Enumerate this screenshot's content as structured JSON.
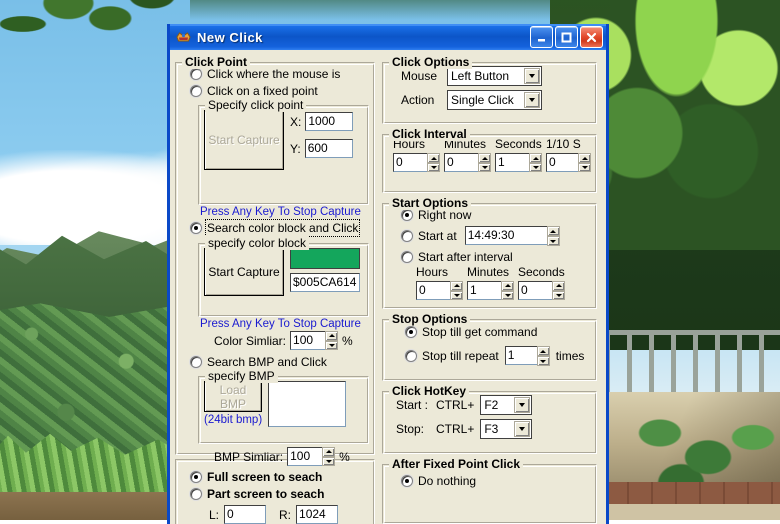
{
  "window": {
    "title": "New Click",
    "icon": "app-crown-icon",
    "buttons": {
      "minimize": "minimize-icon",
      "maximize": "maximize-icon",
      "close": "close-icon"
    }
  },
  "click_point": {
    "title": "Click Point",
    "options": [
      {
        "label": "Click where the mouse is",
        "selected": false
      },
      {
        "label": "Click on a fixed point",
        "selected": false
      },
      {
        "label": "Search color block and Click",
        "selected": true,
        "focused": true
      },
      {
        "label": "Search BMP and Click",
        "selected": false
      }
    ],
    "specify_click_point": {
      "title": "Specify click point",
      "capture_button": "Start Capture",
      "capture_enabled": false,
      "x_label": "X:",
      "x_value": "1000",
      "y_label": "Y:",
      "y_value": "600",
      "hint": "Press Any Key To Stop Capture"
    },
    "specify_color_block": {
      "title": "specify color block",
      "capture_button": "Start Capture",
      "swatch_color": "#14a65c",
      "color_value": "$005CA614",
      "hint": "Press Any Key To Stop Capture",
      "similar_label": "Color Simliar:",
      "similar_value": "100",
      "percent": "%"
    },
    "specify_bmp": {
      "title": "specify BMP",
      "load_button": "Load BMP",
      "load_enabled": false,
      "note": "(24bit bmp)",
      "similar_label": "BMP Simliar:",
      "similar_value": "100",
      "percent": "%"
    },
    "screen_scope": {
      "full": {
        "label": "Full screen to seach",
        "selected": true
      },
      "part": {
        "label": "Part screen to seach",
        "selected": false
      },
      "left_label": "L:",
      "left_value": "0",
      "right_label": "R:",
      "right_value": "1024"
    }
  },
  "click_options": {
    "title": "Click Options",
    "mouse_label": "Mouse",
    "mouse_value": "Left Button",
    "action_label": "Action",
    "action_value": "Single Click"
  },
  "click_interval": {
    "title": "Click Interval",
    "fields": [
      {
        "label": "Hours",
        "value": "0"
      },
      {
        "label": "Minutes",
        "value": "0"
      },
      {
        "label": "Seconds",
        "value": "1"
      },
      {
        "label": "1/10 S",
        "value": "0"
      }
    ]
  },
  "start_options": {
    "title": "Start Options",
    "right_now": {
      "label": "Right now",
      "selected": true
    },
    "start_at": {
      "label": "Start at",
      "selected": false,
      "value": "14:49:30"
    },
    "start_after": {
      "label": "Start after interval",
      "selected": false
    },
    "interval_fields": [
      {
        "label": "Hours",
        "value": "0"
      },
      {
        "label": "Minutes",
        "value": "1"
      },
      {
        "label": "Seconds",
        "value": "0"
      }
    ]
  },
  "stop_options": {
    "title": "Stop Options",
    "till_command": {
      "label": "Stop till get command",
      "selected": true
    },
    "till_repeat": {
      "label": "Stop till repeat",
      "selected": false,
      "value": "1",
      "suffix": "times"
    }
  },
  "click_hotkey": {
    "title": "Click HotKey",
    "start_label": "Start :",
    "start_modifier": "CTRL+",
    "start_key": "F2",
    "stop_label": "Stop:",
    "stop_modifier": "CTRL+",
    "stop_key": "F3"
  },
  "after_fixed_point_click": {
    "title": "After Fixed Point Click",
    "do_nothing": {
      "label": "Do nothing",
      "selected": true
    }
  }
}
